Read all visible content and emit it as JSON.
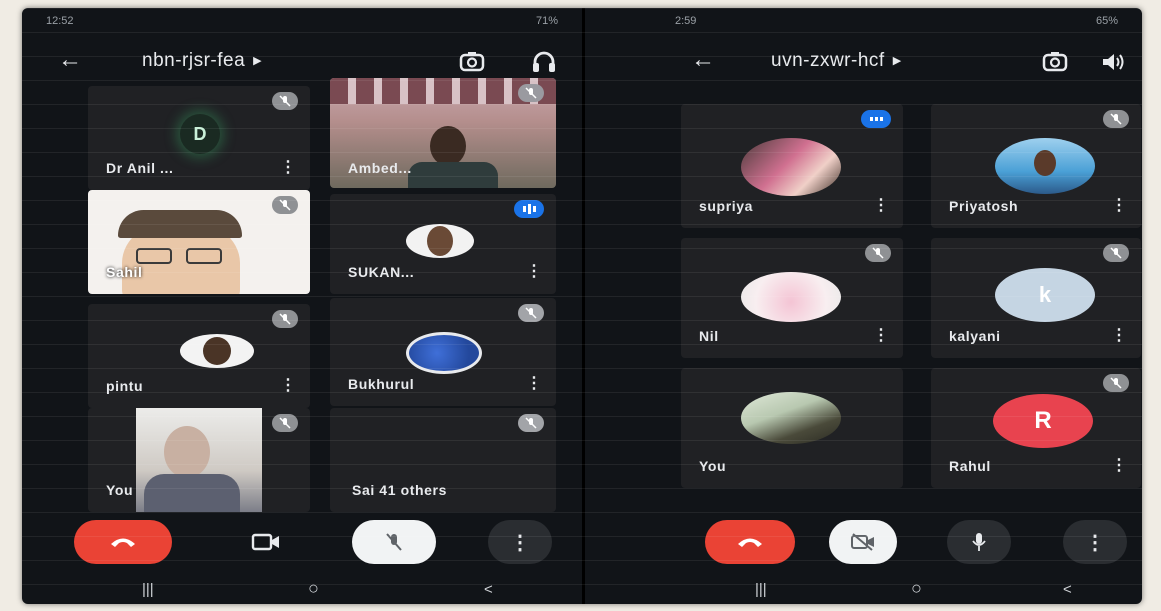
{
  "left": {
    "status": {
      "time": "12:52",
      "battery": "71%"
    },
    "meeting_code": "nbn-rjsr-fea",
    "participants": [
      {
        "name": "Dr Anil ...",
        "initial": "D"
      },
      {
        "name": "Ambed..."
      },
      {
        "name": "Sahil"
      },
      {
        "name": "SUKAN..."
      },
      {
        "name": "pintu"
      },
      {
        "name": "Bukhurul"
      },
      {
        "name": "You"
      },
      {
        "name": "Sai  41 others"
      }
    ]
  },
  "right": {
    "status": {
      "time": "2:59",
      "battery": "65%"
    },
    "meeting_code": "uvn-zxwr-hcf",
    "participants": [
      {
        "name": "supriya"
      },
      {
        "name": "Priyatosh"
      },
      {
        "name": "Nil"
      },
      {
        "name": "kalyani",
        "initial": "k"
      },
      {
        "name": "You"
      },
      {
        "name": "Rahul",
        "initial": "R"
      }
    ]
  },
  "colors": {
    "end_call": "#ea4335",
    "tile": "#202124",
    "speaking": "#1a73e8",
    "avatar_kalyani": "#c5d5e3",
    "avatar_rahul": "#e8434f",
    "avatar_d": "#1a2a22"
  },
  "icons": [
    "back-arrow-icon",
    "switch-camera-icon",
    "headphones-icon",
    "speaker-icon",
    "end-call-icon",
    "camera-icon",
    "mic-off-icon",
    "mic-icon",
    "more-vert-icon"
  ]
}
